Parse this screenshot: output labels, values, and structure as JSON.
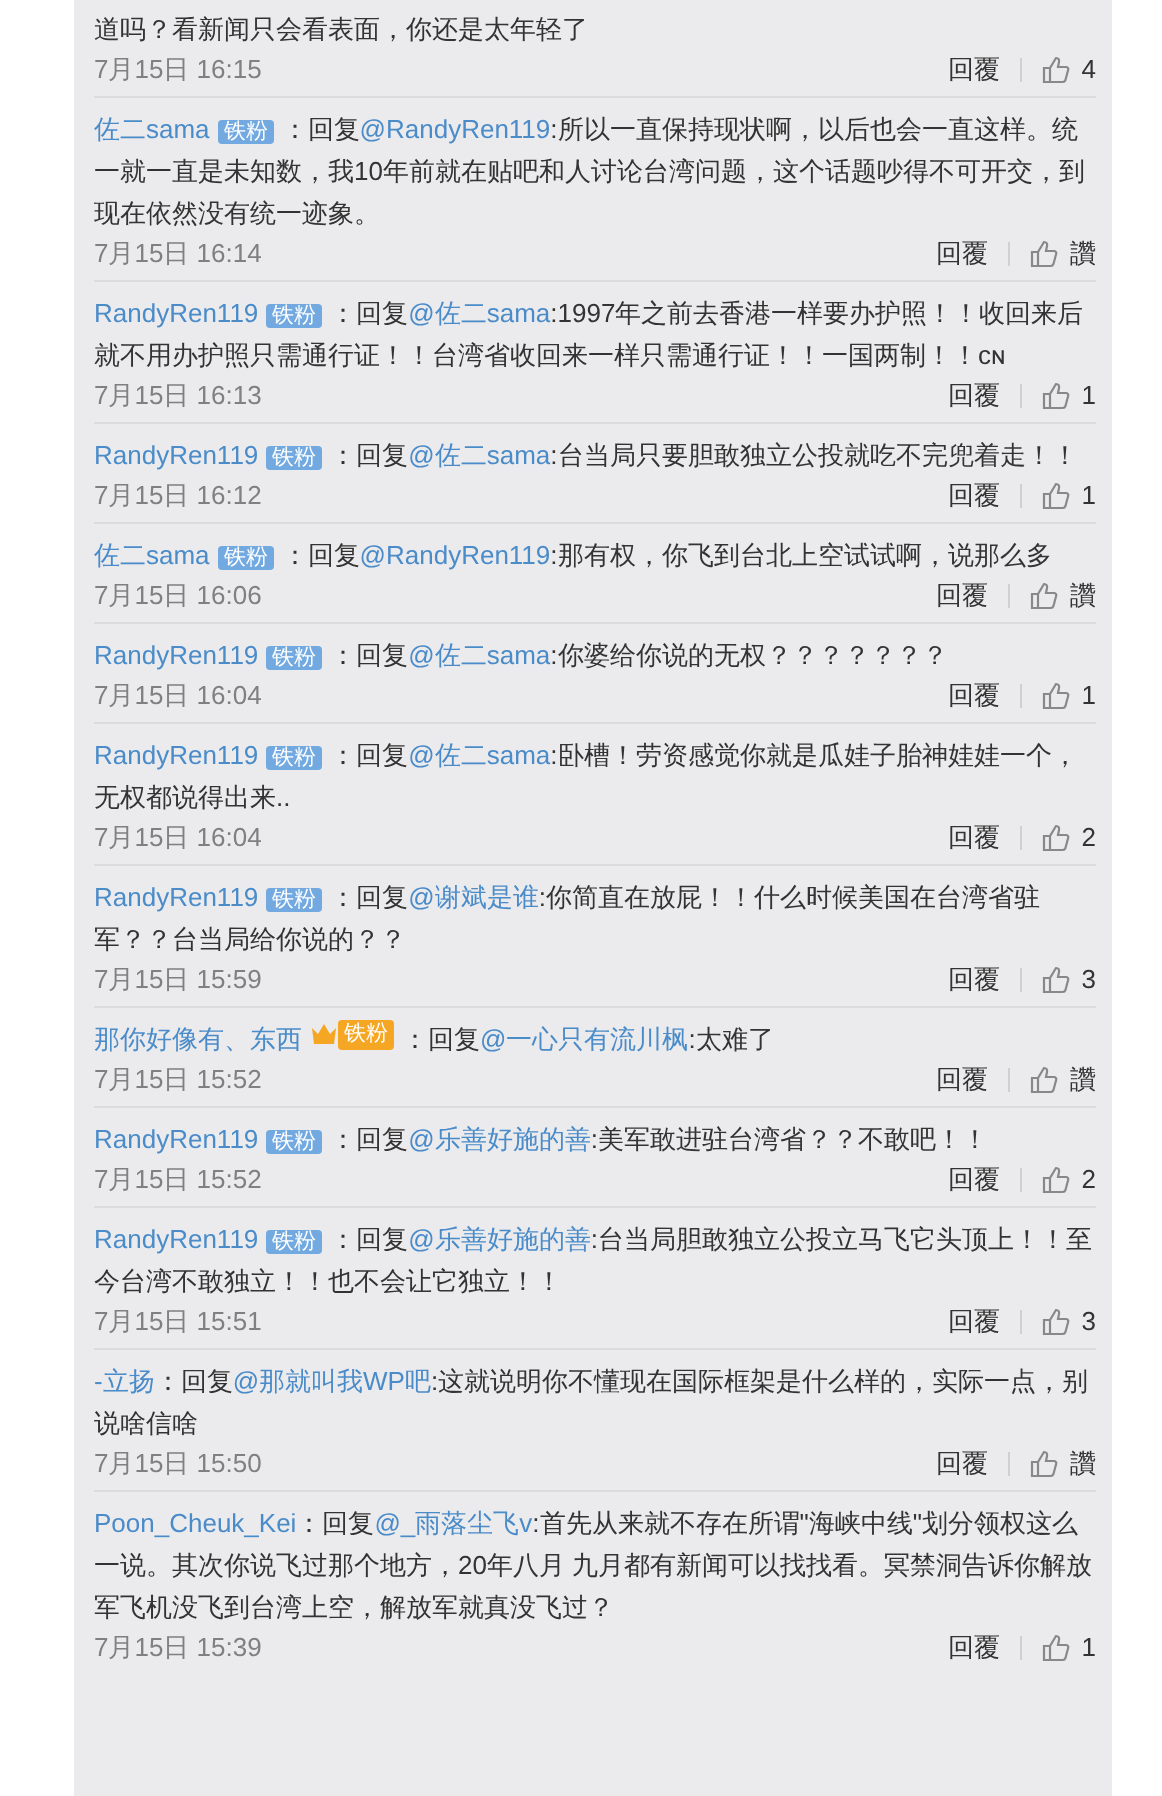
{
  "comments": [
    {
      "text": "道吗？看新闻只会看表面，你还是太年轻了",
      "time": "7月15日 16:15",
      "reply": "回覆",
      "likes": "4"
    },
    {
      "user": "佐二sama",
      "badge": {
        "kind": "fan",
        "text": "铁粉"
      },
      "reply_prefix": "：回复",
      "reply_to": "@RandyRen119",
      "text": ":所以一直保持现状啊，以后也会一直这样。统一就一直是未知数，我10年前就在贴吧和人讨论台湾问题，这个话题吵得不可开交，到现在依然没有统一迹象。",
      "time": "7月15日 16:14",
      "reply": "回覆",
      "likes": "讚"
    },
    {
      "user": "RandyRen119",
      "badge": {
        "kind": "fan",
        "text": "铁粉"
      },
      "reply_prefix": "：回复",
      "reply_to": "@佐二sama",
      "text": ":1997年之前去香港一样要办护照！！收回来后就不用办护照只需通行证！！台湾省收回来一样只需通行证！！一国两制！！ᴄɴ",
      "time": "7月15日 16:13",
      "reply": "回覆",
      "likes": "1"
    },
    {
      "user": "RandyRen119",
      "badge": {
        "kind": "fan",
        "text": "铁粉"
      },
      "reply_prefix": "：回复",
      "reply_to": "@佐二sama",
      "text": ":台当局只要胆敢独立公投就吃不完兜着走！！",
      "time": "7月15日 16:12",
      "reply": "回覆",
      "likes": "1"
    },
    {
      "user": "佐二sama",
      "badge": {
        "kind": "fan",
        "text": "铁粉"
      },
      "reply_prefix": "：回复",
      "reply_to": "@RandyRen119",
      "text": ":那有权，你飞到台北上空试试啊，说那么多",
      "time": "7月15日 16:06",
      "reply": "回覆",
      "likes": "讚"
    },
    {
      "user": "RandyRen119",
      "badge": {
        "kind": "fan",
        "text": "铁粉"
      },
      "reply_prefix": "：回复",
      "reply_to": "@佐二sama",
      "text": ":你婆给你说的无权？？？？？？？",
      "time": "7月15日 16:04",
      "reply": "回覆",
      "likes": "1"
    },
    {
      "user": "RandyRen119",
      "badge": {
        "kind": "fan",
        "text": "铁粉"
      },
      "reply_prefix": "：回复",
      "reply_to": "@佐二sama",
      "text": ":卧槽！劳资感觉你就是瓜娃子胎神娃娃一个，无权都说得出来..",
      "time": "7月15日 16:04",
      "reply": "回覆",
      "likes": "2"
    },
    {
      "user": "RandyRen119",
      "badge": {
        "kind": "fan",
        "text": "铁粉"
      },
      "reply_prefix": "：回复",
      "reply_to": "@谢斌是谁",
      "text": ":你简直在放屁！！什么时候美国在台湾省驻军？？台当局给你说的？？",
      "time": "7月15日 15:59",
      "reply": "回覆",
      "likes": "3"
    },
    {
      "user": "那你好像有、东西",
      "badge": {
        "kind": "vip",
        "text": "铁粉"
      },
      "reply_prefix": "：回复",
      "reply_to": "@一心只有流川枫",
      "text": ":太难了",
      "time": "7月15日 15:52",
      "reply": "回覆",
      "likes": "讚"
    },
    {
      "user": "RandyRen119",
      "badge": {
        "kind": "fan",
        "text": "铁粉"
      },
      "reply_prefix": "：回复",
      "reply_to": "@乐善好施的善",
      "text": ":美军敢进驻台湾省？？不敢吧！！",
      "time": "7月15日 15:52",
      "reply": "回覆",
      "likes": "2"
    },
    {
      "user": "RandyRen119",
      "badge": {
        "kind": "fan",
        "text": "铁粉"
      },
      "reply_prefix": "：回复",
      "reply_to": "@乐善好施的善",
      "text": ":台当局胆敢独立公投立马飞它头顶上！！至今台湾不敢独立！！也不会让它独立！！",
      "time": "7月15日 15:51",
      "reply": "回覆",
      "likes": "3"
    },
    {
      "user": "-立扬",
      "reply_prefix": "：回复",
      "reply_to": "@那就叫我WP吧",
      "text": ":这就说明你不懂现在国际框架是什么样的，实际一点，别说啥信啥",
      "time": "7月15日 15:50",
      "reply": "回覆",
      "likes": "讚"
    },
    {
      "user": "Poon_Cheuk_Kei",
      "reply_prefix": "：回复",
      "reply_to": "@_雨落尘飞v",
      "text": ":首先从来就不存在所谓\"海峡中线\"划分领权这么一说。其次你说飞过那个地方，20年八月 九月都有新闻可以找找看。冥禁洞告诉你解放军飞机没飞到台湾上空，解放军就真没飞过？",
      "time": "7月15日 15:39",
      "reply": "回覆",
      "likes": "1"
    }
  ]
}
